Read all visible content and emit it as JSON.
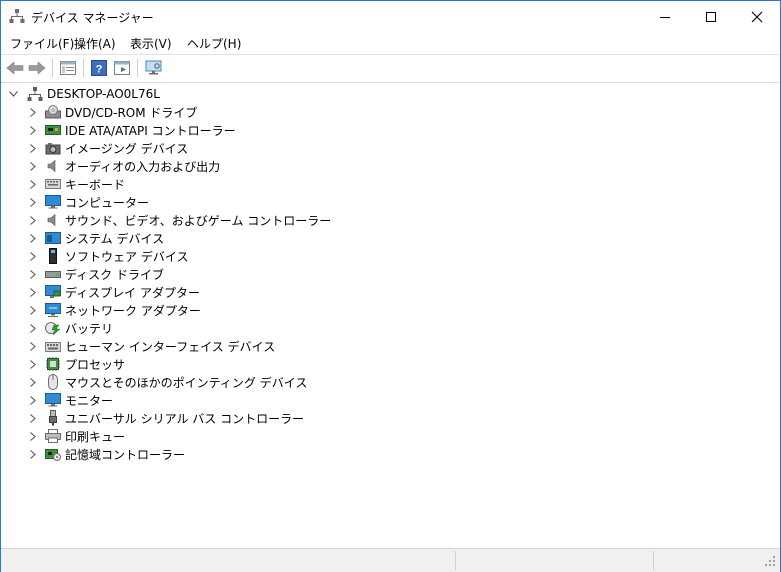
{
  "window": {
    "title": "デバイス マネージャー"
  },
  "menu": {
    "file": "ファイル(F)",
    "action": "操作(A)",
    "view": "表示(V)",
    "help": "ヘルプ(H)"
  },
  "toolbar": {
    "icons": [
      "back-arrow-icon",
      "forward-arrow-icon",
      "properties-icon",
      "help-icon",
      "update-driver-icon",
      "scan-hardware-icon"
    ]
  },
  "tree": {
    "root": "DESKTOP-AO0L76L",
    "categories": [
      {
        "label": "DVD/CD-ROM ドライブ",
        "icon": "dvd-drive-icon"
      },
      {
        "label": "IDE ATA/ATAPI コントローラー",
        "icon": "ide-controller-icon"
      },
      {
        "label": "イメージング デバイス",
        "icon": "imaging-device-icon"
      },
      {
        "label": "オーディオの入力および出力",
        "icon": "speaker-icon"
      },
      {
        "label": "キーボード",
        "icon": "keyboard-icon"
      },
      {
        "label": "コンピューター",
        "icon": "computer-icon"
      },
      {
        "label": "サウンド、ビデオ、およびゲーム コントローラー",
        "icon": "sound-icon"
      },
      {
        "label": "システム デバイス",
        "icon": "system-device-icon"
      },
      {
        "label": "ソフトウェア デバイス",
        "icon": "software-device-icon"
      },
      {
        "label": "ディスク ドライブ",
        "icon": "disk-drive-icon"
      },
      {
        "label": "ディスプレイ アダプター",
        "icon": "display-adapter-icon"
      },
      {
        "label": "ネットワーク アダプター",
        "icon": "network-adapter-icon"
      },
      {
        "label": "バッテリ",
        "icon": "battery-icon"
      },
      {
        "label": "ヒューマン インターフェイス デバイス",
        "icon": "hid-icon"
      },
      {
        "label": "プロセッサ",
        "icon": "processor-icon"
      },
      {
        "label": "マウスとそのほかのポインティング デバイス",
        "icon": "mouse-icon"
      },
      {
        "label": "モニター",
        "icon": "monitor-icon"
      },
      {
        "label": "ユニバーサル シリアル バス コントローラー",
        "icon": "usb-icon"
      },
      {
        "label": "印刷キュー",
        "icon": "printer-icon"
      },
      {
        "label": "記憶域コントローラー",
        "icon": "storage-controller-icon"
      }
    ]
  },
  "colors": {
    "window_border": "#2b79d6",
    "statusbar": "#f0f0f0"
  }
}
